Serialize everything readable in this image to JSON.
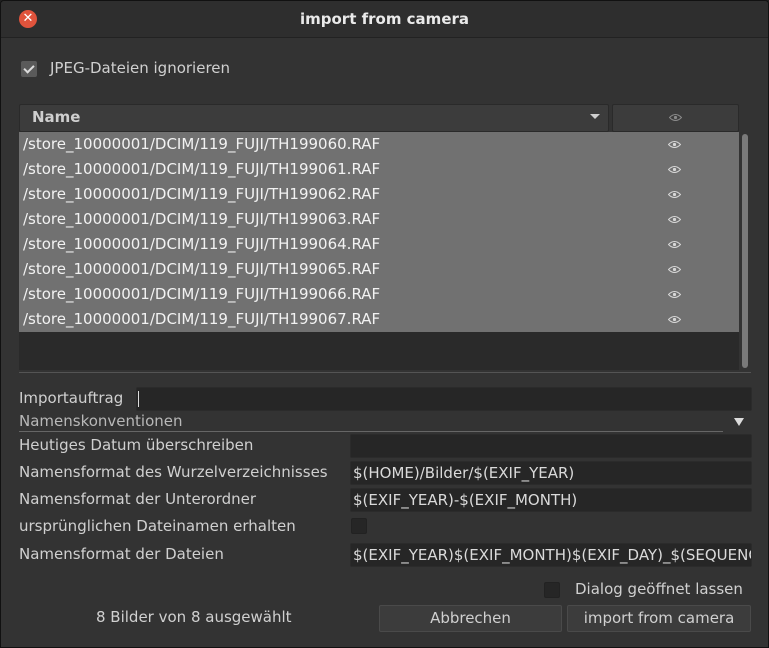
{
  "window": {
    "title": "import from camera"
  },
  "ignore_jpeg": {
    "label": "JPEG-Dateien ignorieren",
    "checked": true
  },
  "file_list": {
    "header_name": "Name",
    "header_icon": "eye-icon",
    "rows": [
      {
        "path": "/store_10000001/DCIM/119_FUJI/TH199060.RAF",
        "icon": "eye-icon"
      },
      {
        "path": "/store_10000001/DCIM/119_FUJI/TH199061.RAF",
        "icon": "eye-icon"
      },
      {
        "path": "/store_10000001/DCIM/119_FUJI/TH199062.RAF",
        "icon": "eye-icon"
      },
      {
        "path": "/store_10000001/DCIM/119_FUJI/TH199063.RAF",
        "icon": "eye-icon"
      },
      {
        "path": "/store_10000001/DCIM/119_FUJI/TH199064.RAF",
        "icon": "eye-icon"
      },
      {
        "path": "/store_10000001/DCIM/119_FUJI/TH199065.RAF",
        "icon": "eye-icon"
      },
      {
        "path": "/store_10000001/DCIM/119_FUJI/TH199066.RAF",
        "icon": "eye-icon"
      },
      {
        "path": "/store_10000001/DCIM/119_FUJI/TH199067.RAF",
        "icon": "eye-icon"
      }
    ]
  },
  "import_job": {
    "label": "Importauftrag",
    "value": ""
  },
  "naming": {
    "section_label": "Namenskonventionen",
    "override_date": {
      "label": "Heutiges Datum überschreiben",
      "value": ""
    },
    "base_dir": {
      "label": "Namensformat des Wurzelverzeichnisses",
      "value": "$(HOME)/Bilder/$(EXIF_YEAR)"
    },
    "subdir": {
      "label": "Namensformat der Unterordner",
      "value": "$(EXIF_YEAR)-$(EXIF_MONTH)"
    },
    "keep_original": {
      "label": "ursprünglichen Dateinamen erhalten",
      "checked": false
    },
    "filename": {
      "label": "Namensformat der Dateien",
      "value": "$(EXIF_YEAR)$(EXIF_MONTH)$(EXIF_DAY)_$(SEQUENCE).$(FILE_EXTENSION)"
    }
  },
  "keep_dialog_open": {
    "label": "Dialog geöffnet lassen",
    "checked": false
  },
  "footer": {
    "status": "8 Bilder von 8 ausgewählt",
    "cancel_label": "Abbrechen",
    "import_label": "import from camera"
  },
  "colors": {
    "close_button": "#e0533c",
    "row_selected": "#717171",
    "dialog_bg": "#333333"
  }
}
